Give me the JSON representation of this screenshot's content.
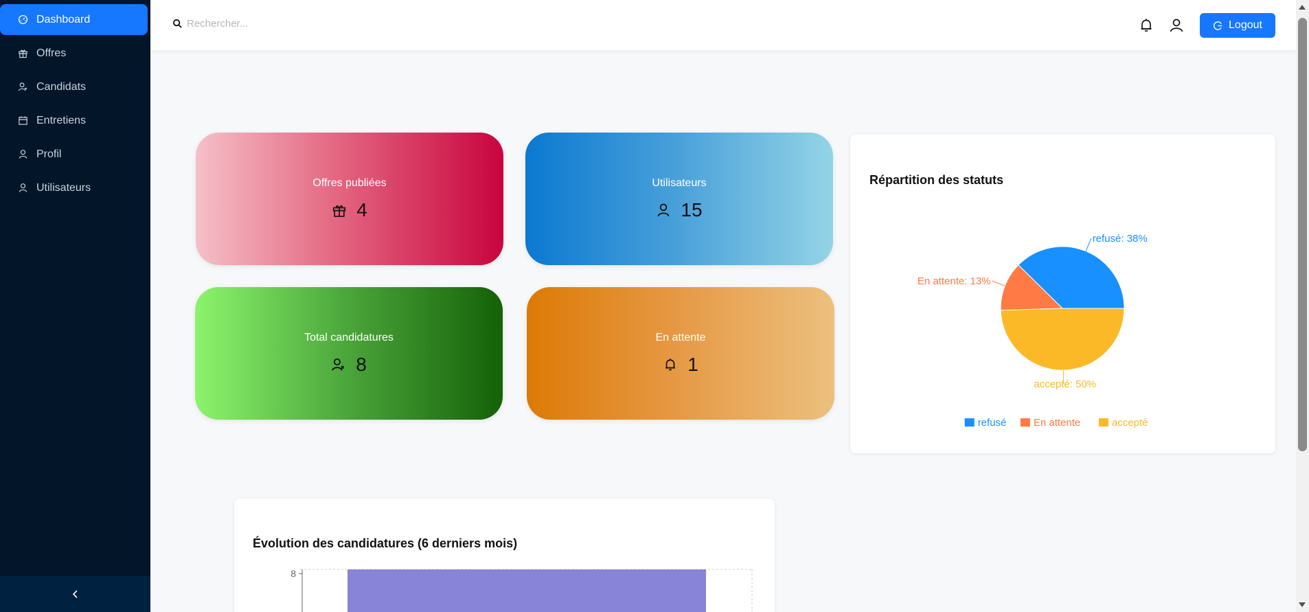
{
  "sidebar": {
    "items": [
      {
        "label": "Dashboard",
        "icon": "dashboard-icon",
        "active": true
      },
      {
        "label": "Offres",
        "icon": "gift-icon"
      },
      {
        "label": "Candidats",
        "icon": "users-icon"
      },
      {
        "label": "Entretiens",
        "icon": "calendar-icon"
      },
      {
        "label": "Profil",
        "icon": "user-icon"
      },
      {
        "label": "Utilisateurs",
        "icon": "user-icon"
      }
    ],
    "collapse_icon": "chevron-left-icon"
  },
  "header": {
    "search_placeholder": "Rechercher...",
    "logout_label": "Logout",
    "accent": "#1677ff"
  },
  "stats": [
    {
      "label": "Offres publiées",
      "value": "4",
      "icon": "gift-icon"
    },
    {
      "label": "Utilisateurs",
      "value": "15",
      "icon": "user-icon"
    },
    {
      "label": "Total candidatures",
      "value": "8",
      "icon": "users-icon"
    },
    {
      "label": "En attente",
      "value": "1",
      "icon": "bell-icon"
    }
  ],
  "pie": {
    "title": "Répartition des statuts",
    "chart_data": {
      "type": "pie",
      "slices": [
        {
          "name": "refusé",
          "value": 38,
          "label": "refusé: 38%",
          "color": "#1890ff"
        },
        {
          "name": "En attente",
          "value": 13,
          "label": "En attente: 13%",
          "color": "#ff7a45"
        },
        {
          "name": "accepté",
          "value": 50,
          "label": "accepté: 50%",
          "color": "#fbb928"
        }
      ],
      "legend": "bottom"
    }
  },
  "bar": {
    "title": "Évolution des candidatures (6 derniers mois)",
    "chart_data": {
      "type": "bar",
      "y_ticks": [
        "8"
      ],
      "ylim": [
        0,
        8
      ],
      "color": "#8884d8",
      "grid": true
    }
  }
}
